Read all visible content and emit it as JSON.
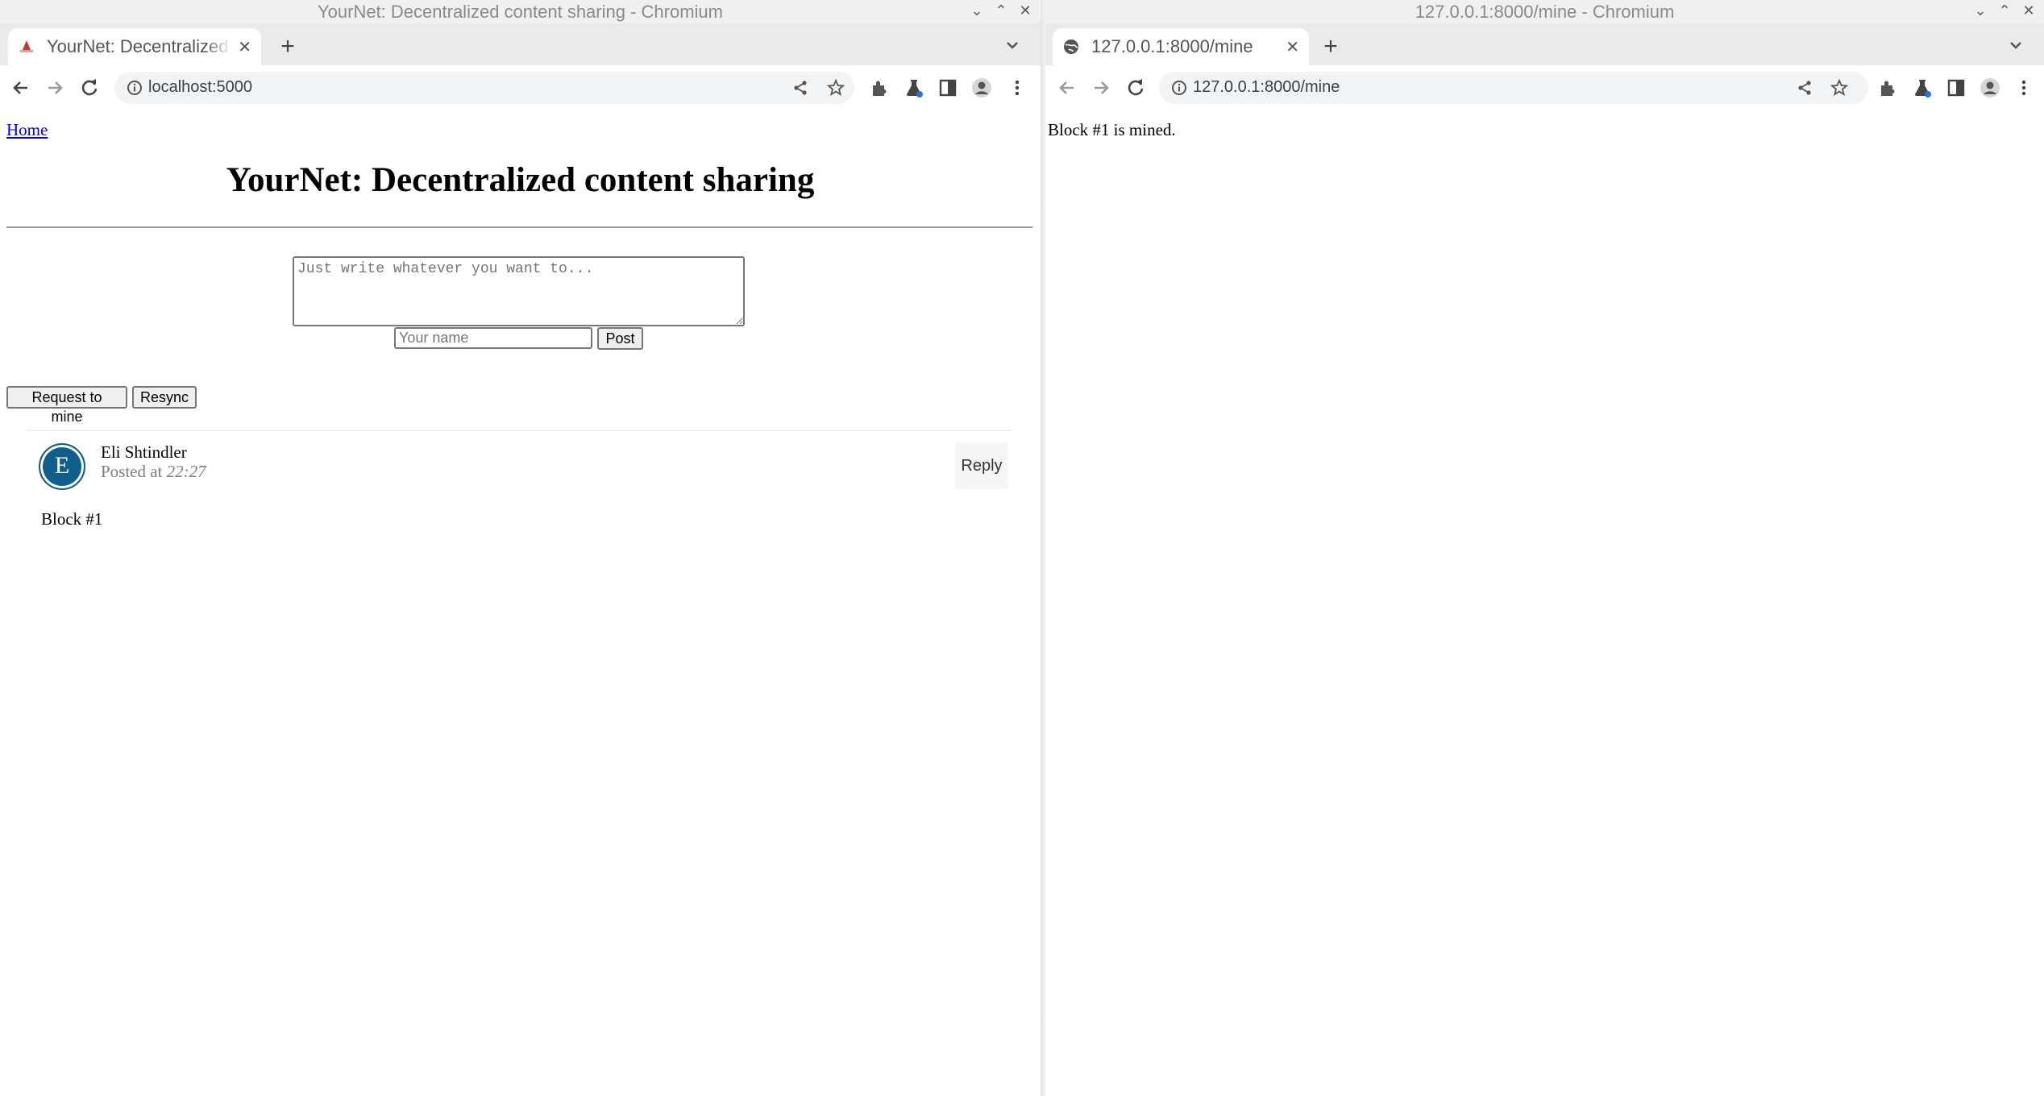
{
  "left_window": {
    "window_title": "YourNet: Decentralized content sharing - Chromium",
    "tab_title": "YourNet: Decentralized c",
    "url": "localhost:5000",
    "page": {
      "home_link": "Home",
      "heading": "YourNet: Decentralized content sharing",
      "textarea_placeholder": "Just write whatever you want to...",
      "name_placeholder": "Your name",
      "post_button": "Post",
      "mine_button": "Request to mine",
      "resync_button": "Resync",
      "posts": [
        {
          "avatar_letter": "E",
          "author": "Eli Shtindler",
          "posted_prefix": "Posted at",
          "posted_time": "22:27",
          "reply_label": "Reply",
          "content": "Block #1"
        }
      ]
    }
  },
  "right_window": {
    "window_title": "127.0.0.1:8000/mine - Chromium",
    "tab_title": "127.0.0.1:8000/mine",
    "url": "127.0.0.1:8000/mine",
    "page": {
      "message": "Block #1 is mined."
    }
  },
  "colors": {
    "link": "#0000ee",
    "avatar": "#0f5e8c",
    "posted_text": "#7d7d7d"
  }
}
